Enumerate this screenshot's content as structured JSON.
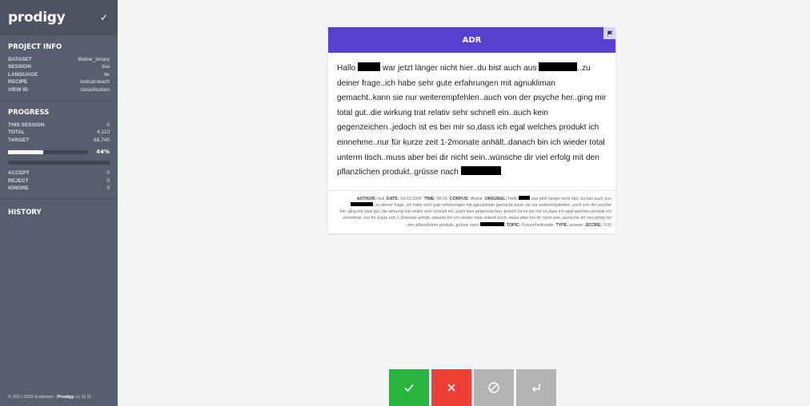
{
  "brand": {
    "name": "prodigy",
    "check": "✓"
  },
  "project_info": {
    "title": "PROJECT INFO",
    "rows": [
      {
        "key": "DATASET",
        "value": "lifeline_binary"
      },
      {
        "key": "SESSION",
        "value": "lisa"
      },
      {
        "key": "LANGUAGE",
        "value": "de"
      },
      {
        "key": "RECIPE",
        "value": "textcat.teach"
      },
      {
        "key": "VIEW ID",
        "value": "classification"
      }
    ]
  },
  "progress": {
    "title": "PROGRESS",
    "rows": [
      {
        "key": "THIS SESSION",
        "value": "0"
      },
      {
        "key": "TOTAL",
        "value": "4,110"
      },
      {
        "key": "TARGET",
        "value": "69,745"
      }
    ],
    "percent_label": "44%",
    "fraction": 0.44,
    "answers": [
      {
        "key": "ACCEPT",
        "value": "0"
      },
      {
        "key": "REJECT",
        "value": "0"
      },
      {
        "key": "IGNORE",
        "value": "0"
      }
    ]
  },
  "history": {
    "title": "HISTORY"
  },
  "footer": {
    "copyright": "© 2017-2022 Explosion",
    "product": "Prodigy",
    "version": "v1.11.5"
  },
  "card": {
    "label": "ADR",
    "text": {
      "p1": "Hallo",
      "p2": "war jetzt länger nicht hier..du bist auch aus",
      "p3": "..zu deiner frage..ich habe sehr gute erfahrungen mit agnukliman gemacht..kann sie nur weiterempfehlen..auch von der psyche her..ging mir total gut..die wirkung trat relativ sehr schnell ein..auch kein gegenzeichen..jedoch ist es bei mir so,dass ich egal welches produkt ich einnehme..nur für kurze zeit 1-2monate anhält..danach bin ich wieder total unterm tisch..muss aber bei dir nicht sein..wünsche dir viel erfolg mit den pflanzlichen produkt..grüsse nach"
    },
    "meta": {
      "author_label": "AUTHOR:",
      "author": "null",
      "date_label": "DATE:",
      "date": "04.03.2006",
      "time_label": "TIME:",
      "time": "08:03",
      "corpus_label": "CORPUS:",
      "corpus": "lifeline",
      "original_label": "ORIGINAL:",
      "orig1": "Hallo",
      "orig2": "war jetzt länger nicht hier..du bist auch aus",
      "orig3": "..zu deiner frage..ich habe sehr gute erfahrungen mit agnukliman gemacht..kann sie nur weiterempfehlen..auch von der psyche her..ging mir total gut..die wirkung trat relativ sehr schnell ein..auch kein gegenzeichen..jedoch ist es bei mir so,dass ich egal welches produkt ich einnehme..nur für kurze zeit 1-2monate anhält..danach bin ich wieder total unterm tisch..muss aber bei dir nicht sein..wünsche dir viel erfolg mit den pflanzlichen produkt..grüsse nach",
      "topic_label": "TOPIC:",
      "topic": "Frauenheilkunde",
      "type_label": "TYPE:",
      "type": "answer",
      "score_label": "SCORE:",
      "score": "0.00"
    }
  },
  "colors": {
    "sidebar": "#555f6d",
    "header": "#583fcf",
    "accept": "#27b53f",
    "reject": "#ec3f35",
    "ignore": "#b3b3b3"
  },
  "actions": [
    {
      "name": "accept",
      "icon": "check-icon"
    },
    {
      "name": "reject",
      "icon": "x-icon"
    },
    {
      "name": "ignore",
      "icon": "ignore-icon"
    },
    {
      "name": "undo",
      "icon": "undo-icon"
    }
  ]
}
